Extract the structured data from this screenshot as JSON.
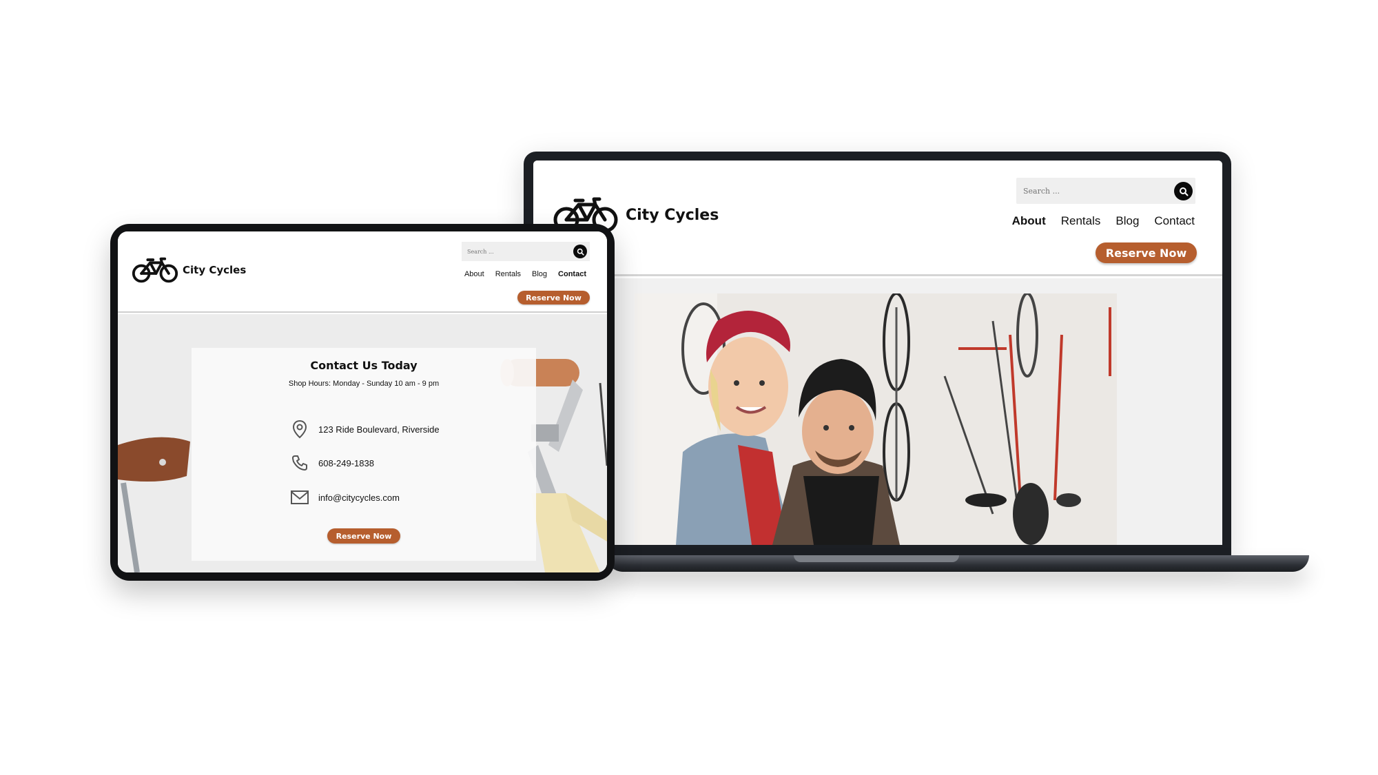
{
  "laptop": {
    "brand": "City Cycles",
    "search": {
      "placeholder": "Search ..."
    },
    "nav": [
      {
        "label": "About",
        "active": true
      },
      {
        "label": "Rentals",
        "active": false
      },
      {
        "label": "Blog",
        "active": false
      },
      {
        "label": "Contact",
        "active": false
      }
    ],
    "reserve_label": "Reserve Now",
    "hero_photo": "two smiling people in a bike shop with hanging bicycles"
  },
  "tablet": {
    "brand": "City Cycles",
    "search": {
      "placeholder": "Search ..."
    },
    "nav": [
      {
        "label": "About",
        "active": false
      },
      {
        "label": "Rentals",
        "active": false
      },
      {
        "label": "Blog",
        "active": false
      },
      {
        "label": "Contact",
        "active": true
      }
    ],
    "reserve_label": "Reserve Now",
    "contact": {
      "title": "Contact Us Today",
      "hours": "Shop Hours: Monday - Sunday  10 am - 9 pm",
      "address": "123 Ride Boulevard, Riverside",
      "phone": "608-249-1838",
      "email": "info@citycycles.com",
      "button_label": "Reserve Now"
    }
  },
  "colors": {
    "accent": "#b65e2e",
    "device_frame": "#1c1f24",
    "page_bg": "#ffffff",
    "hero_bg": "#f1f1f1"
  },
  "icons": [
    "bicycle-logo-icon",
    "search-icon",
    "location-pin-icon",
    "phone-icon",
    "envelope-icon"
  ]
}
